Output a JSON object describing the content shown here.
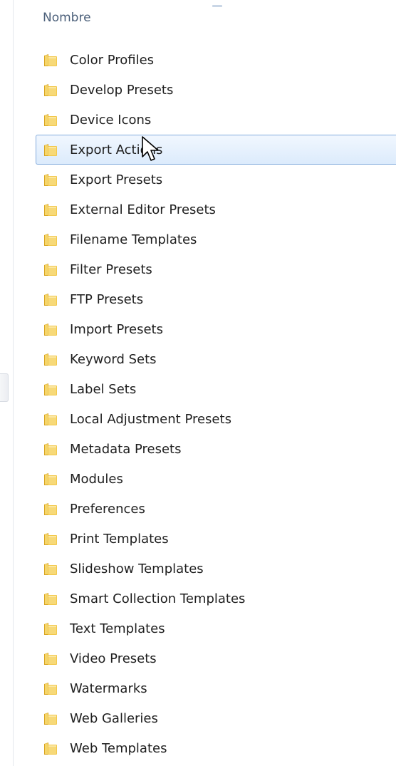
{
  "column_header": "Nombre",
  "icons": {
    "folder": "folder-icon",
    "cursor": "mouse-pointer-icon"
  },
  "colors": {
    "selection_border": "#84acdd",
    "selection_fill": "#dcebfc",
    "header_text": "#4c607a",
    "folder_yellow": "#f2c84b"
  },
  "items": [
    {
      "label": "Color Profiles",
      "selected": false
    },
    {
      "label": "Develop Presets",
      "selected": false
    },
    {
      "label": "Device Icons",
      "selected": false
    },
    {
      "label": "Export Actions",
      "selected": true
    },
    {
      "label": "Export Presets",
      "selected": false
    },
    {
      "label": "External Editor Presets",
      "selected": false
    },
    {
      "label": "Filename Templates",
      "selected": false
    },
    {
      "label": "Filter Presets",
      "selected": false
    },
    {
      "label": "FTP Presets",
      "selected": false
    },
    {
      "label": "Import Presets",
      "selected": false
    },
    {
      "label": "Keyword Sets",
      "selected": false
    },
    {
      "label": "Label Sets",
      "selected": false
    },
    {
      "label": "Local Adjustment Presets",
      "selected": false
    },
    {
      "label": "Metadata Presets",
      "selected": false
    },
    {
      "label": "Modules",
      "selected": false
    },
    {
      "label": "Preferences",
      "selected": false
    },
    {
      "label": "Print Templates",
      "selected": false
    },
    {
      "label": "Slideshow Templates",
      "selected": false
    },
    {
      "label": "Smart Collection Templates",
      "selected": false
    },
    {
      "label": "Text Templates",
      "selected": false
    },
    {
      "label": "Video Presets",
      "selected": false
    },
    {
      "label": "Watermarks",
      "selected": false
    },
    {
      "label": "Web Galleries",
      "selected": false
    },
    {
      "label": "Web Templates",
      "selected": false
    }
  ]
}
